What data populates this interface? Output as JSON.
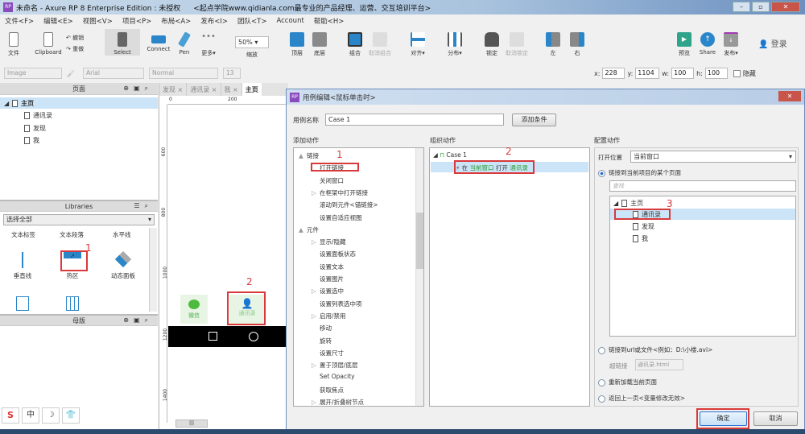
{
  "window": {
    "title": "未命名 - Axure RP 8 Enterprise Edition : 未授权",
    "subtitle": "<起点学院www.qidianla.com最专业的产品经理、运营、交互培训平台>",
    "logo": "RP"
  },
  "menu": [
    "文件<F>",
    "编辑<E>",
    "视图<V>",
    "项目<P>",
    "布局<A>",
    "发布<I>",
    "团队<T>",
    "Account",
    "帮助<H>"
  ],
  "toolbar": {
    "file": "文件",
    "clipboard": "Clipboard",
    "undo": "撤销",
    "redo": "重做",
    "select": "Select",
    "connect": "Connect",
    "pen": "Pen",
    "more": "更多▾",
    "zoom": "50%",
    "zoom_label": "缩放",
    "top": "顶层",
    "bottom": "底层",
    "group": "组合",
    "ungroup": "取消组合",
    "align": "对齐▾",
    "distribute": "分布▾",
    "lock": "锁定",
    "unlock": "取消锁定",
    "left": "左",
    "right": "右",
    "preview": "预览",
    "share": "Share",
    "publish": "发布▾",
    "login": "登录"
  },
  "format": {
    "style": "Image",
    "font": "Arial",
    "weight": "Normal",
    "size": "13",
    "x_label": "x:",
    "x": "228",
    "y_label": "y:",
    "y": "1104",
    "w_label": "w:",
    "w": "100",
    "h_label": "h:",
    "h": "100",
    "hidden": "隐藏"
  },
  "pages": {
    "title": "页面",
    "items": [
      "主页",
      "通讯录",
      "发现",
      "我"
    ]
  },
  "libraries": {
    "title": "Libraries",
    "select": "选择全部",
    "labels": [
      "文本标签",
      "文本段落",
      "水平线"
    ],
    "items": [
      "垂直线",
      "热区",
      "动态面板"
    ]
  },
  "masters": {
    "title": "母版"
  },
  "canvas": {
    "tabs": [
      "发现",
      "通讯录",
      "我",
      "主页"
    ],
    "ruler_top": [
      "0",
      "200"
    ],
    "ruler_left": [
      "600",
      "800",
      "1000",
      "1200",
      "1400"
    ],
    "widgets": [
      "微信",
      "通讯录"
    ]
  },
  "annotations": {
    "n1": "1",
    "n2": "2",
    "n3": "3"
  },
  "dialog": {
    "title": "用例编辑<鼠标单击时>",
    "case_name_label": "用例名称",
    "case_name": "Case 1",
    "add_condition": "添加条件",
    "add_action_title": "添加动作",
    "organize_title": "组织动作",
    "config_title": "配置动作",
    "actions": [
      {
        "label": "链接",
        "level": 0,
        "expand": "▲"
      },
      {
        "label": "打开链接",
        "level": 1
      },
      {
        "label": "关闭窗口",
        "level": 1
      },
      {
        "label": "在框架中打开链接",
        "level": 1,
        "expand": "▷"
      },
      {
        "label": "滚动到元件<锚链接>",
        "level": 1
      },
      {
        "label": "设置自适应视图",
        "level": 1
      },
      {
        "label": "元件",
        "level": 0,
        "expand": "▲"
      },
      {
        "label": "显示/隐藏",
        "level": 1,
        "expand": "▷"
      },
      {
        "label": "设置面板状态",
        "level": 1
      },
      {
        "label": "设置文本",
        "level": 1
      },
      {
        "label": "设置图片",
        "level": 1
      },
      {
        "label": "设置选中",
        "level": 1,
        "expand": "▷"
      },
      {
        "label": "设置列表选中项",
        "level": 1
      },
      {
        "label": "启用/禁用",
        "level": 1,
        "expand": "▷"
      },
      {
        "label": "移动",
        "level": 1
      },
      {
        "label": "旋转",
        "level": 1
      },
      {
        "label": "设置尺寸",
        "level": 1
      },
      {
        "label": "置于顶层/底层",
        "level": 1,
        "expand": "▷"
      },
      {
        "label": "Set Opacity",
        "level": 1
      },
      {
        "label": "获取焦点",
        "level": 1
      },
      {
        "label": "展开/折叠树节点",
        "level": 1,
        "expand": "▷"
      }
    ],
    "organize": {
      "case": "Case 1",
      "action_prefix": "在",
      "action_window": "当前窗口",
      "action_mid": "打开",
      "action_target": "通讯录"
    },
    "config": {
      "open_in_label": "打开位置",
      "open_in": "当前窗口",
      "radio_page": "链接到当前项目的某个页面",
      "search_placeholder": "查找",
      "tree": [
        "主页",
        "通讯录",
        "发现",
        "我"
      ],
      "radio_url": "链接到url或文件<例如：D:\\小楼.avi>",
      "hyperlink_label": "超链接",
      "hyperlink": "通讯录.html",
      "radio_reload": "重新加载当前页面",
      "radio_back": "返回上一页<变量修改无效>"
    },
    "ok": "确定",
    "cancel": "取消"
  },
  "colors": {
    "accent": "#2a6fd0",
    "highlight": "#cce4f7",
    "annotation": "#d9393a"
  }
}
